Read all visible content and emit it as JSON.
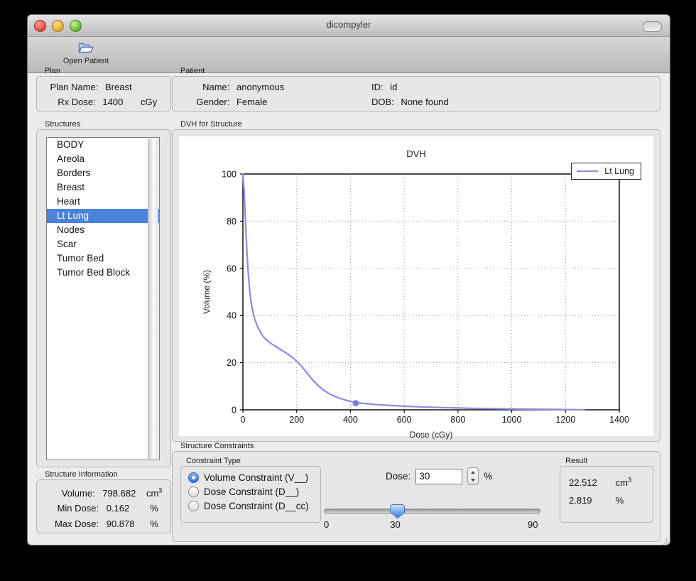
{
  "window": {
    "title": "dicompyler"
  },
  "toolbar": {
    "open_patient_label": "Open Patient",
    "open_patient_icon": "open-folder-icon"
  },
  "plan": {
    "caption": "Plan",
    "name_label": "Plan Name:",
    "name_value": "Breast",
    "rx_label": "Rx Dose:",
    "rx_value": "1400",
    "rx_units": "cGy"
  },
  "patient": {
    "caption": "Patient",
    "name_label": "Name:",
    "name_value": "anonymous",
    "id_label": "ID:",
    "id_value": "id",
    "gender_label": "Gender:",
    "gender_value": "Female",
    "dob_label": "DOB:",
    "dob_value": "None found"
  },
  "structures": {
    "caption": "Structures",
    "items": [
      {
        "label": "BODY",
        "selected": false
      },
      {
        "label": "Areola",
        "selected": false
      },
      {
        "label": "Borders",
        "selected": false
      },
      {
        "label": "Breast",
        "selected": false
      },
      {
        "label": "Heart",
        "selected": false
      },
      {
        "label": "Lt Lung",
        "selected": true
      },
      {
        "label": "Nodes",
        "selected": false
      },
      {
        "label": "Scar",
        "selected": false
      },
      {
        "label": "Tumor Bed",
        "selected": false
      },
      {
        "label": "Tumor Bed Block",
        "selected": false
      }
    ]
  },
  "structure_information": {
    "caption": "Structure Information",
    "volume_label": "Volume:",
    "volume_value": "798.682",
    "volume_units": "cm",
    "volume_units_sup": "3",
    "min_label": "Min Dose:",
    "min_value": "0.162",
    "min_units": "%",
    "max_label": "Max Dose:",
    "max_value": "90.878",
    "max_units": "%"
  },
  "dvh_panel": {
    "caption": "DVH for Structure"
  },
  "chart_data": {
    "type": "line",
    "title": "DVH",
    "xlabel": "Dose (cGy)",
    "ylabel": "Volume (%)",
    "xlim": [
      0,
      1400
    ],
    "ylim": [
      0,
      100
    ],
    "xticks": [
      0,
      200,
      400,
      600,
      800,
      1000,
      1200,
      1400
    ],
    "yticks": [
      0,
      20,
      40,
      60,
      80,
      100
    ],
    "grid": true,
    "legend": {
      "position": "top-right",
      "entries": [
        "Lt Lung"
      ]
    },
    "series": [
      {
        "name": "Lt Lung",
        "color": "#8a8ae0",
        "x": [
          0,
          5,
          10,
          15,
          20,
          25,
          30,
          40,
          50,
          60,
          70,
          80,
          100,
          120,
          140,
          160,
          180,
          200,
          210,
          220,
          240,
          260,
          280,
          300,
          320,
          340,
          360,
          380,
          400,
          420,
          450,
          500,
          550,
          600,
          650,
          700,
          750,
          800,
          850,
          900,
          950,
          1000,
          1050,
          1100,
          1150,
          1200,
          1250,
          1270
        ],
        "y": [
          100,
          92,
          79,
          67,
          58,
          51,
          46,
          40,
          36.5,
          34,
          32,
          30.5,
          28.5,
          27,
          25.6,
          24.2,
          22.6,
          20.6,
          19.5,
          18.2,
          15.4,
          12.6,
          10.3,
          8.4,
          6.9,
          5.8,
          4.9,
          4.2,
          3.6,
          3.1,
          2.7,
          2.2,
          1.85,
          1.55,
          1.3,
          1.1,
          0.92,
          0.78,
          0.65,
          0.54,
          0.45,
          0.37,
          0.3,
          0.24,
          0.18,
          0.12,
          0.05,
          0
        ]
      }
    ],
    "markers": [
      {
        "x": 420,
        "y": 2.8,
        "color": "#7b7bd8",
        "series": "Lt Lung"
      }
    ]
  },
  "constraints": {
    "caption": "Structure Constraints",
    "type_caption": "Constraint Type",
    "options": [
      {
        "label": "Volume Constraint (V__)",
        "selected": true
      },
      {
        "label": "Dose Constraint (D__)",
        "selected": false
      },
      {
        "label": "Dose Constraint (D__cc)",
        "selected": false
      }
    ],
    "dose_label": "Dose:",
    "dose_value": "30",
    "dose_units": "%",
    "slider": {
      "min_label": "0",
      "value_label": "30",
      "max_label": "90",
      "min": 0,
      "max": 90,
      "value": 30
    }
  },
  "result": {
    "caption": "Result",
    "volume_value": "22.512",
    "volume_units": "cm",
    "volume_units_sup": "3",
    "percent_value": "2.819",
    "percent_units": "%"
  }
}
